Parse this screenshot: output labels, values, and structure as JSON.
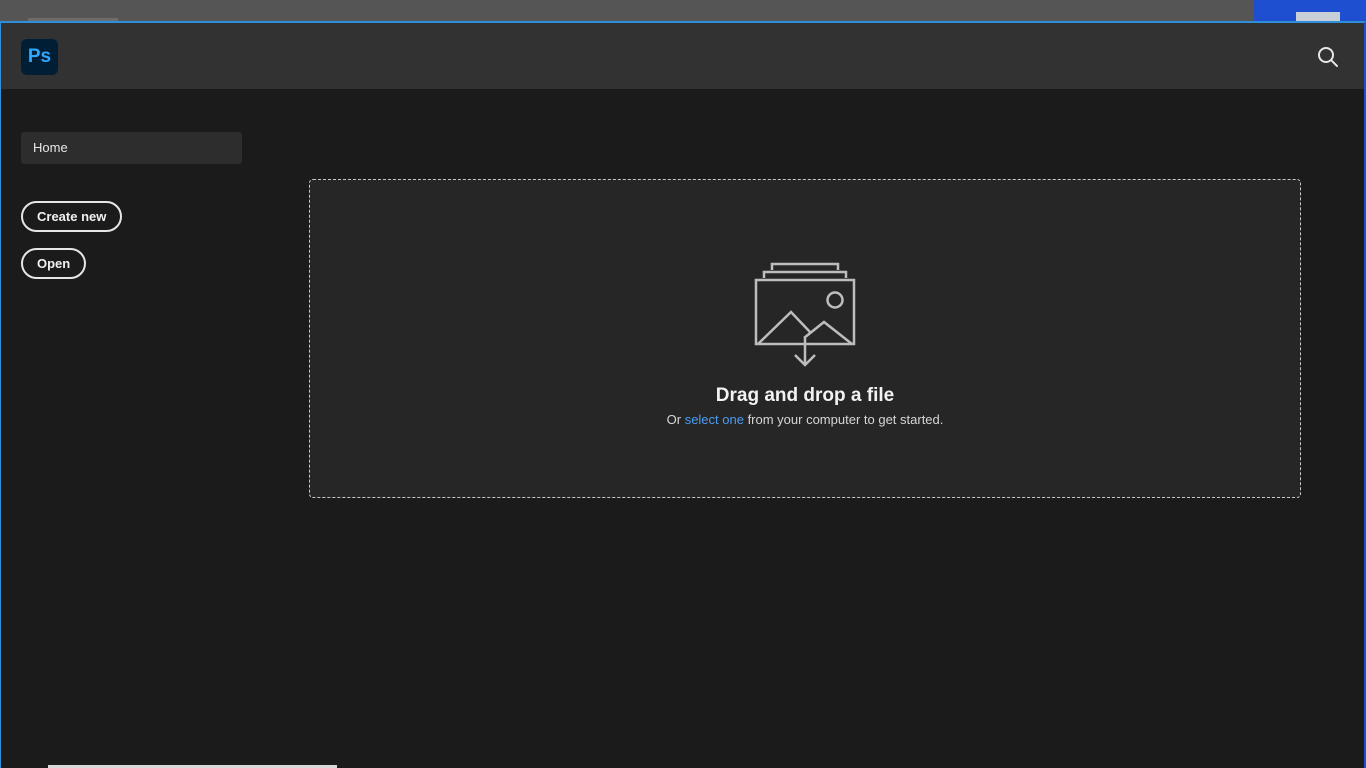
{
  "app": {
    "logo_text": "Ps",
    "logo_icon": "photoshop-logo-icon",
    "accent_color": "#31a8ff",
    "logo_bg_color": "#001e36"
  },
  "header": {
    "search_icon": "search-icon"
  },
  "sidebar": {
    "home_label": "Home",
    "create_new_label": "Create new",
    "open_label": "Open"
  },
  "dropzone": {
    "icon": "image-stack-download-icon",
    "title": "Drag and drop a file",
    "subtitle_prefix": "Or ",
    "subtitle_link": "select one",
    "subtitle_suffix": " from your computer to get started.",
    "link_color": "#4b9cf5"
  }
}
